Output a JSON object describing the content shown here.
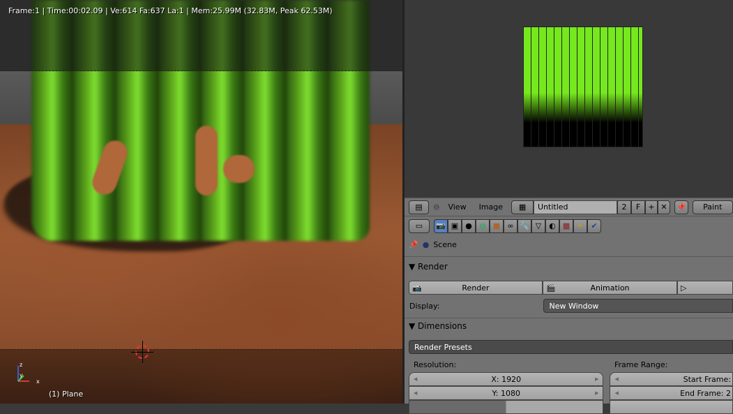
{
  "viewport": {
    "status": "Frame:1 | Time:00:02.09 | Ve:614 Fa:637 La:1 | Mem:25.99M (32.83M, Peak 62.53M)",
    "object": "(1) Plane",
    "axes": {
      "x": "x",
      "y": "y",
      "z": "z"
    }
  },
  "image_editor": {
    "menu": [
      "View",
      "Image"
    ],
    "image_name": "Untitled",
    "users": "2",
    "fake_user": "F",
    "mode": "Paint"
  },
  "properties": {
    "tabs": [
      "render",
      "render-layers",
      "scene",
      "world",
      "object",
      "constraints",
      "modifiers",
      "data",
      "material",
      "texture",
      "particles",
      "physics"
    ],
    "context": "Scene",
    "render_panel": {
      "title": "Render",
      "render_button": "Render",
      "animation_button": "Animation",
      "display_label": "Display:",
      "display_value": "New Window"
    },
    "dimensions_panel": {
      "title": "Dimensions",
      "presets": "Render Presets",
      "resolution_label": "Resolution:",
      "res_x": "X: 1920",
      "res_y": "Y: 1080",
      "frame_range_label": "Frame Range:",
      "start_frame": "Start Frame:",
      "end_frame": "End Frame: 2"
    }
  }
}
